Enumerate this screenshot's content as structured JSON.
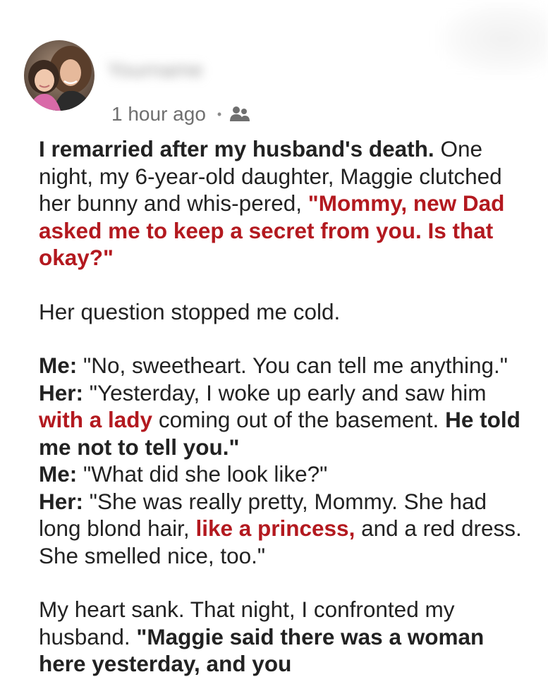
{
  "post": {
    "author_name": "Yourname",
    "timestamp": "1 hour ago",
    "separator": "•",
    "audience_icon": "friends-icon",
    "accent_color": "#b3191f",
    "headline": "I remarried after my husband's death.",
    "para1": {
      "intro": "One night, my 6-year-old daughter, Maggie clutched her bunny and whis-pered,",
      "quote": "\"Mommy, new Dad asked me to keep a secret from you. Is that okay?\""
    },
    "para2": "Her question stopped me cold.",
    "dialogue": {
      "l1_speaker": "Me:",
      "l1_text": "\"No, sweetheart. You can tell me anything.\"",
      "l2_speaker": "Her:",
      "l2_text_a": "\"Yesterday, I woke up early and saw him",
      "l2_red": "with a lady",
      "l2_text_b": "coming out of the basement.",
      "l2_bold": "He told me not to tell you.\"",
      "l3_speaker": "Me:",
      "l3_text": "\"What did she look like?\"",
      "l4_speaker": "Her:",
      "l4_text_a": "\"She was really pretty, Mommy. She had long blond hair,",
      "l4_red": "like a princess,",
      "l4_text_b": "and a red dress. She smelled nice, too.\""
    },
    "para3": {
      "text": "My heart sank. That night, I confronted my husband.",
      "bold": "\"Maggie said there was a woman here yesterday, and you"
    }
  }
}
